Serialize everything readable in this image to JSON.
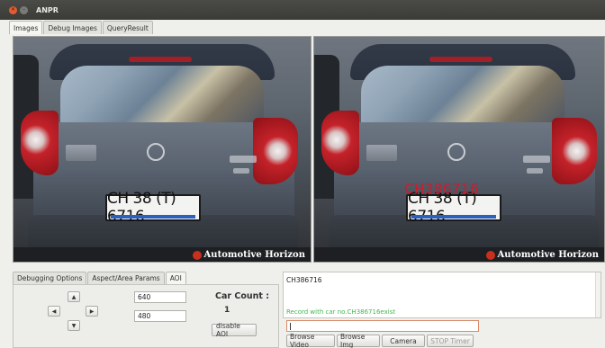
{
  "window": {
    "title": "ANPR"
  },
  "top_tabs": [
    {
      "label": "Images",
      "active": true
    },
    {
      "label": "Debug Images",
      "active": false
    },
    {
      "label": "QueryResult",
      "active": false
    }
  ],
  "left_image": {
    "plate_text": "CH 38 (T) 6716",
    "watermark": "Automotive Horizon"
  },
  "right_image": {
    "plate_text": "CH 38 (T) 6716",
    "detected_label": "CH386716",
    "watermark": "Automotive Horizon"
  },
  "bottom_tabs": [
    {
      "label": "Debugging Options",
      "active": false
    },
    {
      "label": "Aspect/Area Params",
      "active": false
    },
    {
      "label": "AOI",
      "active": true
    }
  ],
  "aoi": {
    "up_glyph": "▲",
    "left_glyph": "◀",
    "right_glyph": "▶",
    "down_glyph": "▼",
    "width_value": "640",
    "height_value": "480",
    "car_count_label": "Car Count :",
    "car_count_value": "1",
    "disable_label": "disable AOI"
  },
  "results": {
    "plate_result": "CH386716",
    "record_message": "Record with car no.CH386716exist",
    "query_value": ""
  },
  "actions": {
    "browse_video": "Browse Video",
    "browse_img": "Browse Img",
    "camera": "Camera",
    "stop_timer": "STOP Timer"
  },
  "colors": {
    "detection_red": "#d21a2a",
    "record_green": "#3fb84f",
    "close_orange": "#e25d33"
  }
}
